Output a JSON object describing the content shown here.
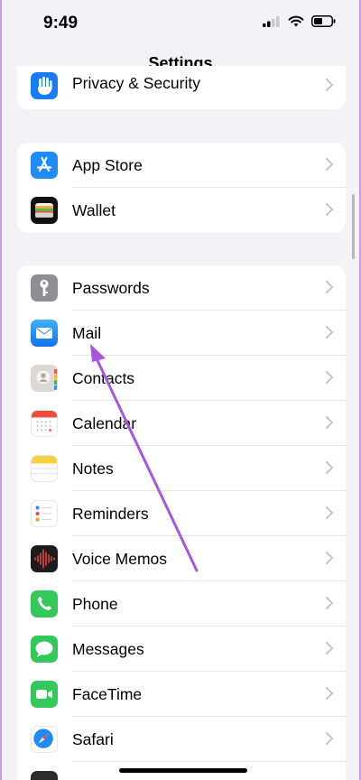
{
  "status": {
    "time": "9:49"
  },
  "nav": {
    "title": "Settings"
  },
  "group0": {
    "items": [
      {
        "label": "Privacy & Security"
      }
    ]
  },
  "group1": {
    "items": [
      {
        "label": "App Store"
      },
      {
        "label": "Wallet"
      }
    ]
  },
  "group2": {
    "items": [
      {
        "label": "Passwords"
      },
      {
        "label": "Mail"
      },
      {
        "label": "Contacts"
      },
      {
        "label": "Calendar"
      },
      {
        "label": "Notes"
      },
      {
        "label": "Reminders"
      },
      {
        "label": "Voice Memos"
      },
      {
        "label": "Phone"
      },
      {
        "label": "Messages"
      },
      {
        "label": "FaceTime"
      },
      {
        "label": "Safari"
      }
    ]
  },
  "colors": {
    "annotation_arrow": "#a855e0",
    "accent_blue": "#1a7cf5",
    "green": "#34c759"
  }
}
